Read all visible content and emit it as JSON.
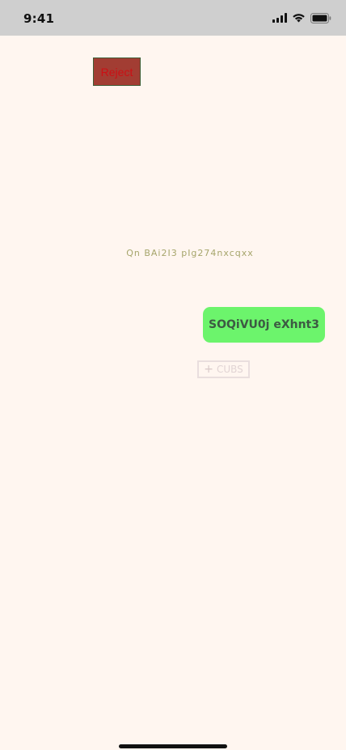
{
  "status_bar": {
    "time": "9:41",
    "icons": [
      "signal-icon",
      "wifi-icon",
      "battery-icon"
    ]
  },
  "reject_button": {
    "label": "Reject"
  },
  "caption": {
    "text": "Qn BAi2I3 pIg274nxcqxx"
  },
  "primary_button": {
    "label": "SOQiVU0j eXhnt3"
  },
  "add_button": {
    "icon": "plus-icon",
    "label": "CUBS"
  },
  "colors": {
    "background": "#fff6f0",
    "status_bar": "#cfcfcf",
    "reject_fill": "#a23d33",
    "reject_text": "#cc0f14",
    "caption_text": "#a6a56b",
    "primary_fill": "#6cf46c",
    "primary_text": "#3d5a43",
    "add_border": "#e9dede"
  }
}
